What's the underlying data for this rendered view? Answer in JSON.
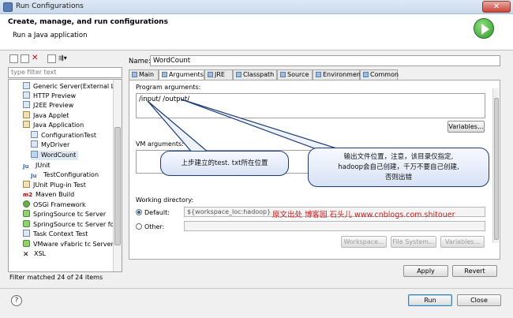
{
  "window": {
    "title": "Run Configurations",
    "close_label": "✕"
  },
  "header": {
    "title": "Create, manage, and run configurations",
    "subtitle": "Run a Java application"
  },
  "filter": {
    "placeholder": "type filter text"
  },
  "tree": {
    "items": [
      {
        "label": "Generic Server(External Laur",
        "icon": "server-icon",
        "level": 1
      },
      {
        "label": "HTTP Preview",
        "icon": "server-icon",
        "level": 1
      },
      {
        "label": "J2EE Preview",
        "icon": "server-icon",
        "level": 1
      },
      {
        "label": "Java Applet",
        "icon": "applet-icon",
        "level": 1
      },
      {
        "label": "Java Application",
        "icon": "java-app-icon",
        "level": 1
      },
      {
        "label": "ConfigurationTest",
        "icon": "java-class-icon",
        "level": 2
      },
      {
        "label": "MyDriver",
        "icon": "java-class-icon",
        "level": 2
      },
      {
        "label": "WordCount",
        "icon": "java-class-icon",
        "level": 2,
        "selected": true
      },
      {
        "label": "JUnit",
        "icon": "junit-icon",
        "level": 1
      },
      {
        "label": "TestConfiguration",
        "icon": "junit-icon",
        "level": 2
      },
      {
        "label": "JUnit Plug-in Test",
        "icon": "junit-plugin-icon",
        "level": 1
      },
      {
        "label": "Maven Build",
        "icon": "maven-icon",
        "level": 1
      },
      {
        "label": "OSGi Framework",
        "icon": "osgi-icon",
        "level": 1
      },
      {
        "label": "SpringSource tc Server",
        "icon": "spring-icon",
        "level": 1
      },
      {
        "label": "SpringSource tc Server for V",
        "icon": "spring-icon",
        "level": 1
      },
      {
        "label": "Task Context Test",
        "icon": "task-icon",
        "level": 1
      },
      {
        "label": "VMware vFabric tc Server",
        "icon": "spring-icon",
        "level": 1
      },
      {
        "label": "XSL",
        "icon": "xsl-icon",
        "level": 1
      }
    ],
    "status": "Filter matched 24 of 24 items"
  },
  "config": {
    "name_label": "Name:",
    "name_value": "WordCount",
    "tabs": [
      "Main",
      "Arguments",
      "JRE",
      "Classpath",
      "Source",
      "Environment",
      "Common"
    ],
    "active_tab": "Arguments",
    "program_args_label": "Program arguments:",
    "program_args_value": "/input/ /output/",
    "variables_label": "Variables...",
    "vm_args_label": "VM arguments:",
    "working_dir_label": "Working directory:",
    "default_label": "Default:",
    "default_value": "${workspace_loc:hadoop}",
    "other_label": "Other:",
    "workspace_label": "Workspace...",
    "filesystem_label": "File System...",
    "variables2_label": "Variables..."
  },
  "annotations": {
    "callout1": "上步建立的test. txt所在位置",
    "callout2_line1": "输出文件位置，注意，该目录仅指定,",
    "callout2_line2": "hadoop会自己创建，千万不要自己创建,",
    "callout2_line3": "否则出错",
    "watermark": "原文出处 博客园 石头儿 www.cnblogs.com.shitouer"
  },
  "buttons": {
    "apply": "Apply",
    "revert": "Revert",
    "run": "Run",
    "close": "Close",
    "help": "?"
  }
}
